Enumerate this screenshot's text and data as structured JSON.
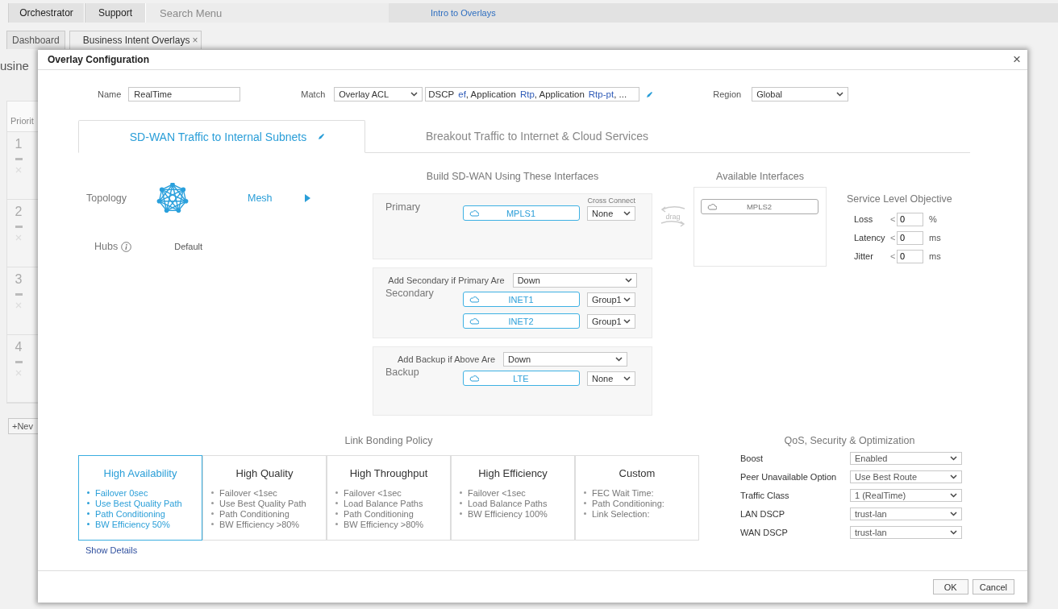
{
  "top_bar": {
    "items": [
      {
        "label": "Orchestrator"
      },
      {
        "label": "Support"
      }
    ],
    "search": {
      "placeholder": "Search Menu"
    },
    "link": "Intro to Overlays"
  },
  "page_tabs": [
    {
      "label": "Dashboard",
      "selected": false
    },
    {
      "label": "Business Intent Overlays",
      "selected": true,
      "close": "×"
    }
  ],
  "page": {
    "heading": "usine",
    "priority_column": {
      "header": "Priorit",
      "rows": [
        "1",
        "2",
        "3",
        "4"
      ]
    },
    "new_button": "+Nev"
  },
  "dialog": {
    "title": "Overlay Configuration",
    "close": "×",
    "name": {
      "label": "Name",
      "value": "RealTime"
    },
    "match": {
      "label": "Match",
      "value": "Overlay ACL",
      "summary": [
        {
          "kind": "key",
          "text": "DSCP"
        },
        {
          "kind": "value",
          "text": "ef"
        },
        {
          "kind": "key",
          "text": ", Application"
        },
        {
          "kind": "value",
          "text": "Rtp"
        },
        {
          "kind": "key",
          "text": ", Application"
        },
        {
          "kind": "value",
          "text": "Rtp-pt"
        },
        {
          "kind": "key",
          "text": ", ..."
        }
      ]
    },
    "region": {
      "label": "Region",
      "value": "Global"
    },
    "tabs": [
      {
        "label": "SD-WAN Traffic to Internal Subnets",
        "selected": true,
        "editable": true
      },
      {
        "label": "Breakout Traffic to Internet & Cloud Services",
        "selected": false,
        "editable": false
      }
    ],
    "topology": {
      "label": "Topology",
      "value": "Mesh"
    },
    "hubs": {
      "label": "Hubs",
      "value": "Default"
    },
    "build": {
      "title": "Build SD-WAN Using These Interfaces",
      "cross_connect_label": "Cross Connect",
      "sections": [
        {
          "kind": "primary",
          "label": "Primary",
          "interfaces": [
            {
              "name": "MPLS1",
              "option": "None"
            }
          ]
        },
        {
          "kind": "secondary",
          "condition_label": "Add Secondary if Primary Are",
          "condition": "Down",
          "label": "Secondary",
          "interfaces": [
            {
              "name": "INET1",
              "option": "Group1"
            },
            {
              "name": "INET2",
              "option": "Group1"
            }
          ]
        },
        {
          "kind": "backup",
          "condition_label": "Add Backup if Above Are",
          "condition": "Down",
          "label": "Backup",
          "interfaces": [
            {
              "name": "LTE",
              "option": "None"
            }
          ]
        }
      ]
    },
    "drag_label": "drag",
    "available": {
      "title": "Available Interfaces",
      "interfaces": [
        "MPLS2"
      ]
    },
    "slo": {
      "title": "Service Level Objective",
      "rows": [
        {
          "label": "Loss",
          "op": "<",
          "value": "0",
          "unit": "%"
        },
        {
          "label": "Latency",
          "op": "<",
          "value": "0",
          "unit": "ms"
        },
        {
          "label": "Jitter",
          "op": "<",
          "value": "0",
          "unit": "ms"
        }
      ]
    },
    "link_bonding": {
      "title": "Link Bonding Policy",
      "policies": [
        {
          "title": "High Availability",
          "selected": true,
          "items": [
            "Failover 0sec",
            "Use Best Quality Path",
            "Path Conditioning",
            "BW Efficiency 50%"
          ]
        },
        {
          "title": "High Quality",
          "selected": false,
          "items": [
            "Failover <1sec",
            "Use Best Quality Path",
            "Path Conditioning",
            "BW Efficiency >80%"
          ]
        },
        {
          "title": "High Throughput",
          "selected": false,
          "items": [
            "Failover <1sec",
            "Load Balance Paths",
            "Path Conditioning",
            "BW Efficiency >80%"
          ]
        },
        {
          "title": "High Efficiency",
          "selected": false,
          "items": [
            "Failover <1sec",
            "Load Balance Paths",
            "BW Efficiency 100%"
          ]
        },
        {
          "title": "Custom",
          "selected": false,
          "items": [
            "FEC Wait Time:",
            "Path Conditioning:",
            "Link Selection:"
          ]
        }
      ],
      "show_details": "Show Details"
    },
    "qos": {
      "title": "QoS, Security & Optimization",
      "rows": [
        {
          "label": "Boost",
          "value": "Enabled"
        },
        {
          "label": "Peer Unavailable Option",
          "value": "Use Best Route"
        },
        {
          "label": "Traffic Class",
          "value": "1 (RealTime)"
        },
        {
          "label": "LAN DSCP",
          "value": "trust-lan"
        },
        {
          "label": "WAN DSCP",
          "value": "trust-lan"
        }
      ]
    },
    "buttons": [
      "OK",
      "Cancel"
    ]
  }
}
